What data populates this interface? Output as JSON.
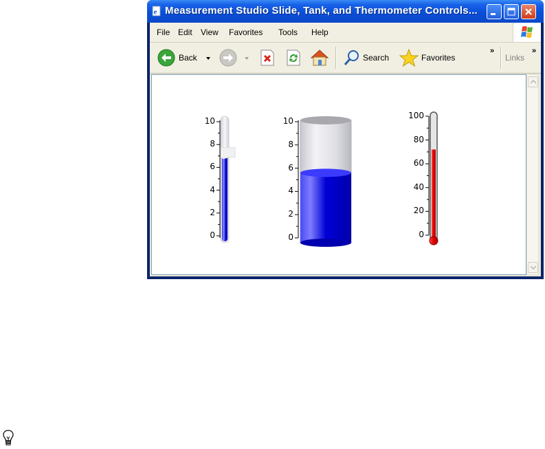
{
  "window": {
    "title": "Measurement Studio Slide, Tank, and Thermometer Controls..."
  },
  "menu": [
    "File",
    "Edit",
    "View",
    "Favorites",
    "Tools",
    "Help"
  ],
  "toolbar": {
    "back_label": "Back",
    "search_label": "Search",
    "favorites_label": "Favorites",
    "links_label": "Links",
    "chevron": "»"
  },
  "gauges": {
    "slide": {
      "ticks": [
        "10",
        "8",
        "6",
        "4",
        "2",
        "0"
      ],
      "value": 7,
      "max": 10
    },
    "tank": {
      "ticks": [
        "10",
        "8",
        "6",
        "4",
        "2",
        "0"
      ],
      "value": 5.6,
      "max": 10
    },
    "thermometer": {
      "ticks": [
        "100",
        "80",
        "60",
        "40",
        "20",
        "0"
      ],
      "value": 72,
      "max": 100
    }
  },
  "colors": {
    "fill_blue": "#0000cc",
    "fill_red": "#e00000"
  },
  "icons": {
    "tip": "lightbulb-icon"
  }
}
